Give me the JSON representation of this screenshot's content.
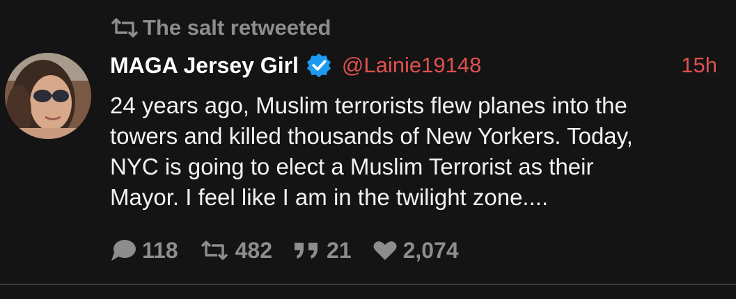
{
  "retweet": {
    "icon": "retweet-icon",
    "text": "The salt retweeted"
  },
  "author": {
    "display_name": "MAGA Jersey Girl",
    "verified_icon": "verified-check-icon",
    "handle": "@Lainie19148",
    "time": "15h"
  },
  "tweet": {
    "lines": [
      "24 years ago, Muslim terrorists flew planes into the",
      "towers and killed thousands of New Yorkers.  Today,",
      "NYC is going to elect a Muslim Terrorist as their",
      "Mayor.  I feel like I am in the twilight zone...."
    ]
  },
  "actions": {
    "replies": "118",
    "retweets": "482",
    "quotes": "21",
    "likes": "2,074"
  },
  "colors": {
    "background": "#141414",
    "accent": "#e0504e",
    "muted": "#8d8d8d",
    "verified": "#1d9bf0"
  }
}
